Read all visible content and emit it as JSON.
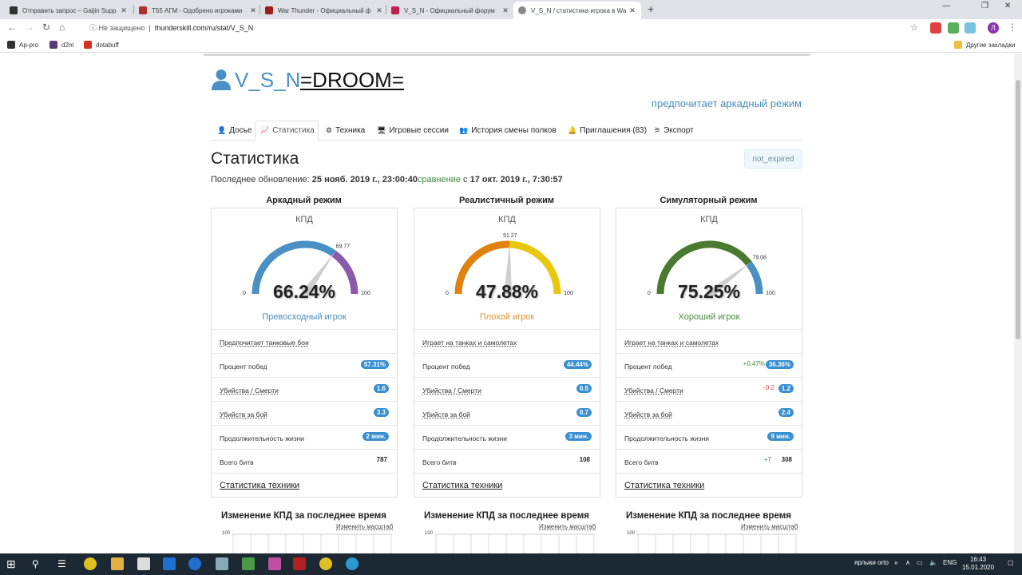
{
  "browser": {
    "tabs": [
      {
        "title": "Отправить запрос – Gaijin Supp"
      },
      {
        "title": "T55 АГМ - Одобрено игроками"
      },
      {
        "title": "War Thunder - Официальный ф"
      },
      {
        "title": "V_S_N - Официальный форум"
      },
      {
        "title": "V_S_N / статистика игрока в Wa"
      }
    ],
    "new_tab": "+",
    "security": "Не защищено",
    "url": "thunderskill.com/ru/stat/V_S_N",
    "bookmarks": [
      {
        "label": "Ap-pro"
      },
      {
        "label": "d2m"
      },
      {
        "label": "dotabuff"
      }
    ],
    "other_bookmarks": "Другие закладки",
    "profile_letter": "Л"
  },
  "header": {
    "username": "V_S_N",
    "clan": "=DROOM=",
    "preference": "предпочитает аркадный режим"
  },
  "nav": {
    "tabs": [
      {
        "label": "Досье",
        "icon": "user-icon"
      },
      {
        "label": "Статистика",
        "icon": "chart-icon"
      },
      {
        "label": "Техника",
        "icon": "gear-icon"
      },
      {
        "label": "Игровые сессии",
        "icon": "monitor-icon"
      },
      {
        "label": "История смены полков",
        "icon": "users-icon"
      },
      {
        "label": "Приглашения (83)",
        "icon": "bell-icon"
      },
      {
        "label": "Экспорт",
        "icon": "rss-icon"
      }
    ]
  },
  "stats": {
    "title": "Статистика",
    "badge": "not_expired",
    "update_prefix": "Последнее обновление: ",
    "update_date": "25 нояб. 2019 г., 23:00:40",
    "compare_link": "сравнение",
    "compare_prefix": " с ",
    "compare_date": "17 окт. 2019 г., 7:30:57"
  },
  "modes": [
    {
      "name": "Аркадный режим",
      "kpd_label": "КПД",
      "value_text": "66.24%",
      "value": 66.24,
      "marker": 69.77,
      "marker_text": "69.77",
      "min": "0",
      "max": "100",
      "rating": "Превосходный игрок",
      "rating_color": "#4a8bb8",
      "colors": [
        "#4a90c4",
        "#8a5aa8"
      ],
      "rows": [
        {
          "label": "Предпочитает танковые бои",
          "value": "",
          "delta": ""
        },
        {
          "label": "Процент побед",
          "value": "57.31%",
          "delta": ""
        },
        {
          "label": "Убийства / Смерти",
          "value": "1.6",
          "delta": ""
        },
        {
          "label": "Убийств за бой",
          "value": "3.3",
          "delta": ""
        },
        {
          "label": "Продолжительность жизни",
          "value": "2 мин.",
          "delta": ""
        },
        {
          "label": "Всего битв",
          "value": "787",
          "delta": ""
        }
      ],
      "footer": "Статистика техники",
      "chart_title": "Изменение КПД за последнее время",
      "scale_link": "Изменить масштаб",
      "axis_top": "100"
    },
    {
      "name": "Реалистичный режим",
      "kpd_label": "КПД",
      "value_text": "47.88%",
      "value": 47.88,
      "marker": 51.27,
      "marker_text": "51.27",
      "min": "0",
      "max": "100",
      "rating": "Плохой игрок",
      "rating_color": "#e0902a",
      "colors": [
        "#e0820e",
        "#e8c80e"
      ],
      "rows": [
        {
          "label": "Играет на танках и самолетах",
          "value": "",
          "delta": ""
        },
        {
          "label": "Процент побед",
          "value": "44.44%",
          "delta": ""
        },
        {
          "label": "Убийства / Смерти",
          "value": "0.5",
          "delta": ""
        },
        {
          "label": "Убийств за бой",
          "value": "0.7",
          "delta": ""
        },
        {
          "label": "Продолжительность жизни",
          "value": "3 мин.",
          "delta": ""
        },
        {
          "label": "Всего битв",
          "value": "108",
          "delta": ""
        }
      ],
      "footer": "Статистика техники",
      "chart_title": "Изменение КПД за последнее время",
      "scale_link": "Изменить масштаб",
      "axis_top": "100"
    },
    {
      "name": "Симуляторный режим",
      "kpd_label": "КПД",
      "value_text": "75.25%",
      "value": 75.25,
      "marker": 79.08,
      "marker_text": "79.08",
      "min": "0",
      "max": "100",
      "rating": "Хороший игрок",
      "rating_color": "#4a8a3a",
      "colors": [
        "#4a7a30",
        "#4a90c4"
      ],
      "rows": [
        {
          "label": "Играет на танках и самолетах",
          "value": "",
          "delta": ""
        },
        {
          "label": "Процент побед",
          "value": "36.36%",
          "delta": "+0.47%"
        },
        {
          "label": "Убийства / Смерти",
          "value": "1.2",
          "delta": "-0.2"
        },
        {
          "label": "Убийств за бой",
          "value": "2.4",
          "delta": ""
        },
        {
          "label": "Продолжительность жизни",
          "value": "9 мин.",
          "delta": ""
        },
        {
          "label": "Всего битв",
          "value": "308",
          "delta": "+7"
        }
      ],
      "footer": "Статистика техники",
      "chart_title": "Изменение КПД за последнее время",
      "scale_link": "Изменить масштаб",
      "axis_top": "100"
    }
  ],
  "taskbar": {
    "tray_text": "ярлыки orto",
    "lang": "ENG",
    "time": "16:43",
    "date": "15.01.2020"
  }
}
